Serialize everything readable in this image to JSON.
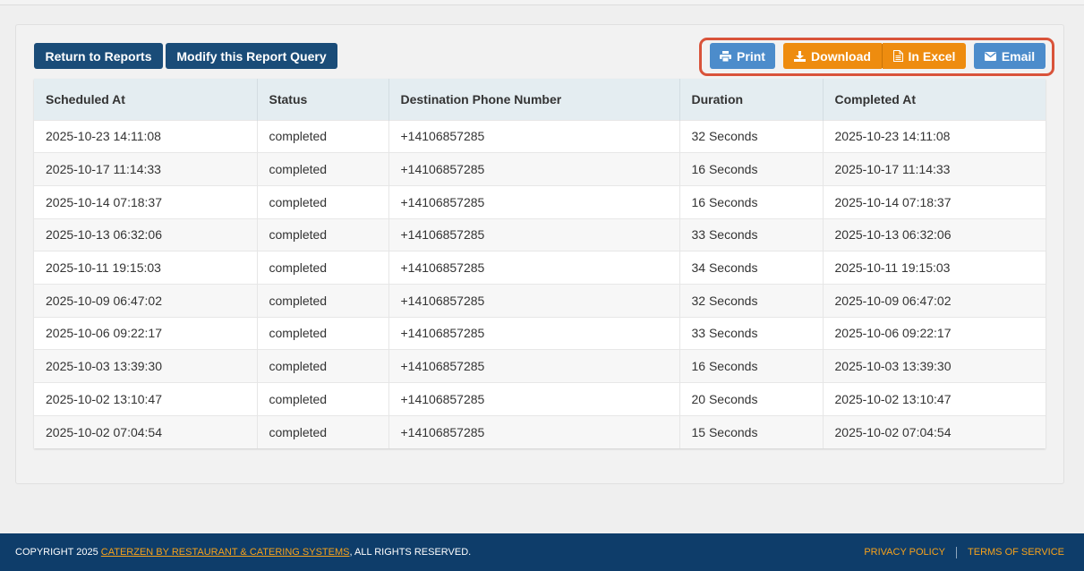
{
  "toolbar": {
    "return_label": "Return to Reports",
    "modify_label": "Modify this Report Query",
    "print_label": "Print",
    "download_label": "Download",
    "excel_label": "In Excel",
    "email_label": "Email"
  },
  "colors": {
    "navy": "#1a4c78",
    "blue": "#4c8ccb",
    "orange": "#ee8c0f",
    "highlight": "#d9533a",
    "footer": "#0e3d6a",
    "footer_link": "#f7a21b"
  },
  "table": {
    "headers": [
      "Scheduled At",
      "Status",
      "Destination Phone Number",
      "Duration",
      "Completed At"
    ],
    "rows": [
      [
        "2025-10-23 14:11:08",
        "completed",
        "+14106857285",
        "32 Seconds",
        "2025-10-23 14:11:08"
      ],
      [
        "2025-10-17 11:14:33",
        "completed",
        "+14106857285",
        "16 Seconds",
        "2025-10-17 11:14:33"
      ],
      [
        "2025-10-14 07:18:37",
        "completed",
        "+14106857285",
        "16 Seconds",
        "2025-10-14 07:18:37"
      ],
      [
        "2025-10-13 06:32:06",
        "completed",
        "+14106857285",
        "33 Seconds",
        "2025-10-13 06:32:06"
      ],
      [
        "2025-10-11 19:15:03",
        "completed",
        "+14106857285",
        "34 Seconds",
        "2025-10-11 19:15:03"
      ],
      [
        "2025-10-09 06:47:02",
        "completed",
        "+14106857285",
        "32 Seconds",
        "2025-10-09 06:47:02"
      ],
      [
        "2025-10-06 09:22:17",
        "completed",
        "+14106857285",
        "33 Seconds",
        "2025-10-06 09:22:17"
      ],
      [
        "2025-10-03 13:39:30",
        "completed",
        "+14106857285",
        "16 Seconds",
        "2025-10-03 13:39:30"
      ],
      [
        "2025-10-02 13:10:47",
        "completed",
        "+14106857285",
        "20 Seconds",
        "2025-10-02 13:10:47"
      ],
      [
        "2025-10-02 07:04:54",
        "completed",
        "+14106857285",
        "15 Seconds",
        "2025-10-02 07:04:54"
      ]
    ]
  },
  "footer": {
    "copyright_prefix": "COPYRIGHT 2025 ",
    "company_link": "CATERZEN BY RESTAURANT & CATERING SYSTEMS",
    "copyright_suffix": ", ALL RIGHTS RESERVED.",
    "privacy_label": "PRIVACY POLICY",
    "terms_label": "TERMS OF SERVICE"
  }
}
